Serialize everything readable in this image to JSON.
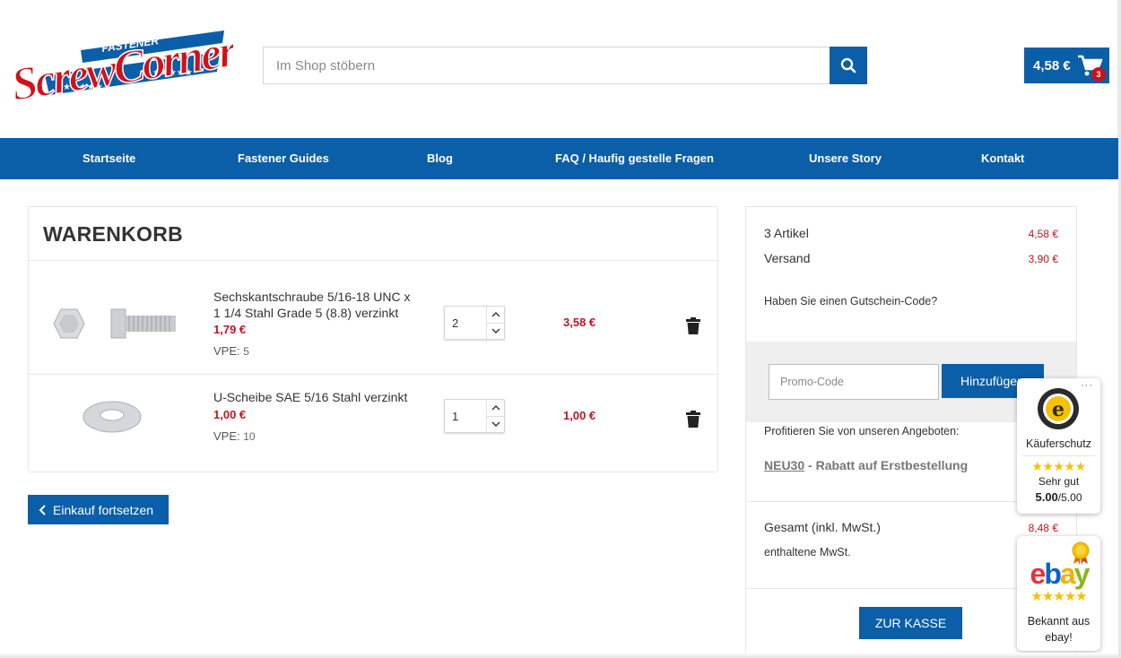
{
  "header": {
    "logo": {
      "top_text": "FASTENER",
      "top_right_text": "SUPERSTORE",
      "main_text": "ScrewCorner"
    },
    "search": {
      "placeholder": "Im Shop stöbern"
    },
    "cart": {
      "total": "4,58 €",
      "count": "3"
    }
  },
  "nav": {
    "items": [
      {
        "label": "Startseite"
      },
      {
        "label": "Fastener Guides"
      },
      {
        "label": "Blog"
      },
      {
        "label": "FAQ / Haufig gestelle Fragen"
      },
      {
        "label": "Unsere Story"
      },
      {
        "label": "Kontakt"
      }
    ]
  },
  "cart": {
    "title": "WARENKORB",
    "items": [
      {
        "name_line1": "Sechskantschraube 5/16-18 UNC x",
        "name_line2": "1 1/4 Stahl Grade 5 (8.8) verzinkt",
        "unit_price": "1,79 €",
        "vpe_label": "VPE:",
        "vpe_value": "5",
        "quantity": "2",
        "line_total": "3,58 €"
      },
      {
        "name_line1": "U-Scheibe SAE 5/16 Stahl verzinkt",
        "unit_price": "1,00 €",
        "vpe_label": "VPE:",
        "vpe_value": "10",
        "quantity": "1",
        "line_total": "1,00 €"
      }
    ],
    "continue_label": "Einkauf fortsetzen"
  },
  "summary": {
    "items_label": "3 Artikel",
    "items_value": "4,58 €",
    "shipping_label": "Versand",
    "shipping_value": "3,90 €",
    "coupon_question": "Haben Sie einen Gutschein-Code?",
    "promo_placeholder": "Promo-Code",
    "promo_button": "Hinzufügen",
    "offers_label": "Profitieren Sie von unseren Angeboten:",
    "offer_code": "NEU30",
    "offer_text": " - Rabatt auf Erstbestellung",
    "total_label": "Gesamt (inkl. MwSt.)",
    "total_value": "8,48 €",
    "vat_label": "enthaltene MwSt.",
    "checkout_label": "ZUR KASSE"
  },
  "trusted_shops": {
    "dots": "···",
    "label": "Käuferschutz",
    "stars": "★★★★★",
    "rating_text": "Sehr gut",
    "score": "5.00",
    "score_max": "/5.00"
  },
  "ebay_badge": {
    "logo": {
      "e": "e",
      "b": "b",
      "a": "a",
      "y": "y"
    },
    "stars": "★★★★★",
    "text_line1": "Bekannt aus",
    "text_line2": "ebay!"
  },
  "colors": {
    "brand_blue": "#0b5ea8",
    "price_red": "#c4131d",
    "star_yellow": "#f5c100"
  }
}
